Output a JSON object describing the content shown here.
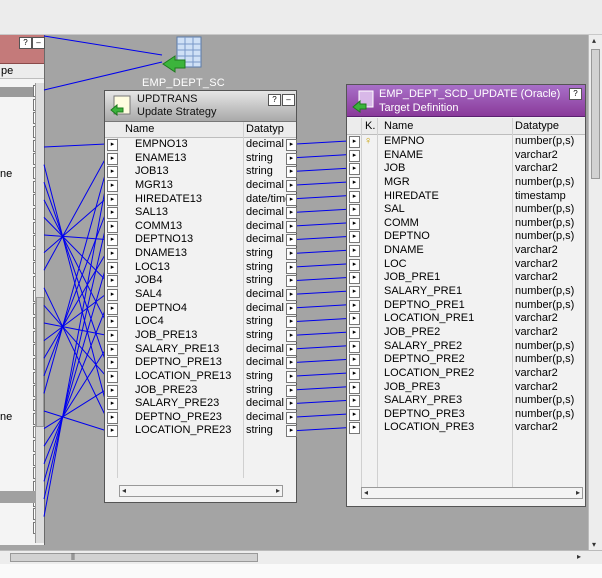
{
  "left_widget": {
    "col_label": "pe",
    "partial_labels": [
      "ne",
      "ne"
    ]
  },
  "strategy_icon": {
    "label": "EMP_DEPT_SC"
  },
  "updtrans": {
    "title": "UPDTRANS",
    "subtitle": "Update Strategy",
    "col_name": "Name",
    "col_datatype": "Datatyp",
    "help_btn": "?",
    "min_btn": "–",
    "rows": [
      {
        "name": "EMPNO13",
        "datatype": "decimal"
      },
      {
        "name": "ENAME13",
        "datatype": "string"
      },
      {
        "name": "JOB13",
        "datatype": "string"
      },
      {
        "name": "MGR13",
        "datatype": "decimal"
      },
      {
        "name": "HIREDATE13",
        "datatype": "date/time"
      },
      {
        "name": "SAL13",
        "datatype": "decimal"
      },
      {
        "name": "COMM13",
        "datatype": "decimal"
      },
      {
        "name": "DEPTNO13",
        "datatype": "decimal"
      },
      {
        "name": "DNAME13",
        "datatype": "string"
      },
      {
        "name": "LOC13",
        "datatype": "string"
      },
      {
        "name": "JOB4",
        "datatype": "string"
      },
      {
        "name": "SAL4",
        "datatype": "decimal"
      },
      {
        "name": "DEPTNO4",
        "datatype": "decimal"
      },
      {
        "name": "LOC4",
        "datatype": "string"
      },
      {
        "name": "JOB_PRE13",
        "datatype": "string"
      },
      {
        "name": "SALARY_PRE13",
        "datatype": "decimal"
      },
      {
        "name": "DEPTNO_PRE13",
        "datatype": "decimal"
      },
      {
        "name": "LOCATION_PRE13",
        "datatype": "string"
      },
      {
        "name": "JOB_PRE23",
        "datatype": "string"
      },
      {
        "name": "SALARY_PRE23",
        "datatype": "decimal"
      },
      {
        "name": "DEPTNO_PRE23",
        "datatype": "decimal"
      },
      {
        "name": "LOCATION_PRE23",
        "datatype": "string"
      }
    ]
  },
  "target": {
    "title": "EMP_DEPT_SCD_UPDATE (Oracle)",
    "subtitle": "Target Definition",
    "col_key": "K.",
    "col_name": "Name",
    "col_datatype": "Datatype",
    "help_btn": "?",
    "key_glyph": "♀",
    "rows": [
      {
        "name": "EMPNO",
        "datatype": "number(p,s)",
        "key": true
      },
      {
        "name": "ENAME",
        "datatype": "varchar2",
        "key": false
      },
      {
        "name": "JOB",
        "datatype": "varchar2",
        "key": false
      },
      {
        "name": "MGR",
        "datatype": "number(p,s)",
        "key": false
      },
      {
        "name": "HIREDATE",
        "datatype": "timestamp",
        "key": false
      },
      {
        "name": "SAL",
        "datatype": "number(p,s)",
        "key": false
      },
      {
        "name": "COMM",
        "datatype": "number(p,s)",
        "key": false
      },
      {
        "name": "DEPTNO",
        "datatype": "number(p,s)",
        "key": false
      },
      {
        "name": "DNAME",
        "datatype": "varchar2",
        "key": false
      },
      {
        "name": "LOC",
        "datatype": "varchar2",
        "key": false
      },
      {
        "name": "JOB_PRE1",
        "datatype": "varchar2",
        "key": false
      },
      {
        "name": "SALARY_PRE1",
        "datatype": "number(p,s)",
        "key": false
      },
      {
        "name": "DEPTNO_PRE1",
        "datatype": "number(p,s)",
        "key": false
      },
      {
        "name": "LOCATION_PRE1",
        "datatype": "varchar2",
        "key": false
      },
      {
        "name": "JOB_PRE2",
        "datatype": "varchar2",
        "key": false
      },
      {
        "name": "SALARY_PRE2",
        "datatype": "number(p,s)",
        "key": false
      },
      {
        "name": "DEPTNO_PRE2",
        "datatype": "number(p,s)",
        "key": false
      },
      {
        "name": "LOCATION_PRE2",
        "datatype": "varchar2",
        "key": false
      },
      {
        "name": "JOB_PRE3",
        "datatype": "varchar2",
        "key": false
      },
      {
        "name": "SALARY_PRE3",
        "datatype": "number(p,s)",
        "key": false
      },
      {
        "name": "DEPTNO_PRE3",
        "datatype": "number(p,s)",
        "key": false
      },
      {
        "name": "LOCATION_PRE3",
        "datatype": "varchar2",
        "key": false
      }
    ]
  },
  "glyphs": {
    "port": "▸",
    "left_arrow": "◂",
    "right_arrow": "▸",
    "up_arrow": "▴",
    "down_arrow": "▾",
    "grip_v": "≡",
    "grip_h": "⦀"
  },
  "colors": {
    "wire": "#0000ee",
    "canvas": "#a4a4a4",
    "target_header": "#8a3a9a",
    "source_header": "#c47a7a"
  }
}
